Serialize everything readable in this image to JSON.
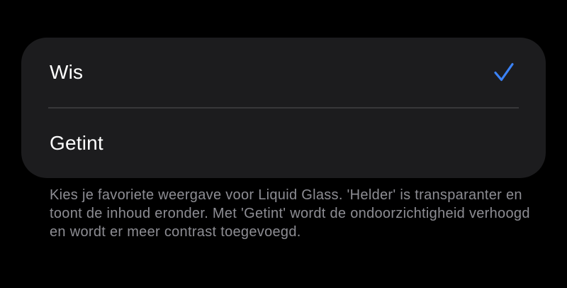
{
  "accent_color": "#3b82f6",
  "options": [
    {
      "label": "Wis",
      "selected": true,
      "indicator_icon": "checkmark-icon"
    },
    {
      "label": "Getint",
      "selected": false
    }
  ],
  "footer": {
    "description": "Kies je favoriete weergave voor Liquid Glass. 'Helder' is transparanter en toont de inhoud eronder. Met 'Getint' wordt de ondoorzichtigheid verhoogd en wordt er meer contrast toegevoegd."
  }
}
